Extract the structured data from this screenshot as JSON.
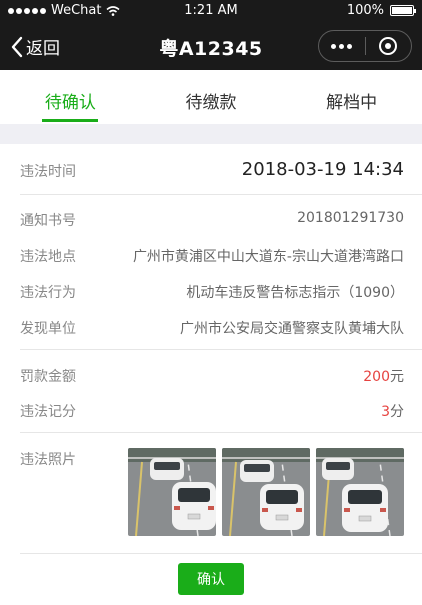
{
  "status_bar": {
    "carrier": "WeChat",
    "time": "1:21 AM",
    "battery": "100%"
  },
  "nav": {
    "back_label": "返回",
    "title": "粤A12345"
  },
  "tabs": [
    {
      "label": "待确认",
      "active": true
    },
    {
      "label": "待缴款",
      "active": false
    },
    {
      "label": "解档中",
      "active": false
    }
  ],
  "detail": {
    "time_label": "违法时间",
    "time_value": "2018-03-19 14:34",
    "notice_label": "通知书号",
    "notice_value": "201801291730",
    "place_label": "违法地点",
    "place_value": "广州市黄浦区中山大道东-宗山大道港湾路口",
    "act_label": "违法行为",
    "act_value": "机动车违反警告标志指示（1090）",
    "unit_label": "发现单位",
    "unit_value": "广州市公安局交通警察支队黄埔大队",
    "fine_label": "罚款金额",
    "fine_amount": "200",
    "fine_unit": "元",
    "points_label": "违法记分",
    "points_amount": "3",
    "points_unit": "分",
    "photo_label": "违法照片"
  },
  "photos": [
    {
      "name": "violation-photo-1"
    },
    {
      "name": "violation-photo-2"
    },
    {
      "name": "violation-photo-3"
    }
  ],
  "actions": {
    "confirm_label": "确认"
  },
  "colors": {
    "accent": "#1aad19",
    "highlight": "#e64340",
    "topbar": "#1a1a1a"
  }
}
